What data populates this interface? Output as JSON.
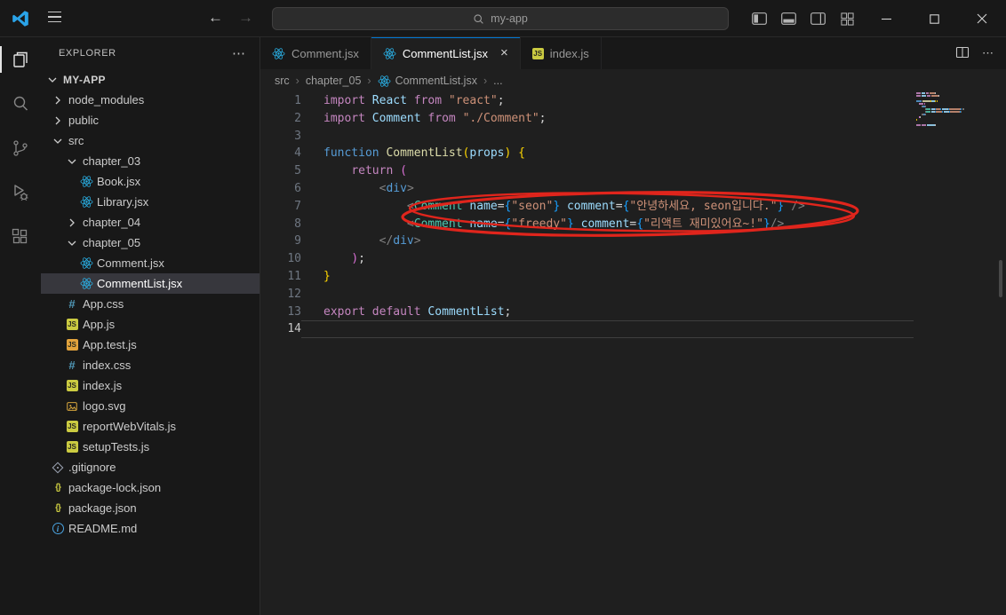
{
  "icons": {
    "more": "⋯",
    "close": "×",
    "crumb_sep": "›"
  },
  "titlebar": {
    "search": "my-app"
  },
  "activity_bar": {
    "items": [
      "explorer",
      "search",
      "source-control",
      "run-debug",
      "extensions"
    ],
    "active": "explorer"
  },
  "explorer": {
    "header": "EXPLORER",
    "root": "MY-APP",
    "items": [
      {
        "label": "node_modules",
        "kind": "folder",
        "depth": 1,
        "expanded": false
      },
      {
        "label": "public",
        "kind": "folder",
        "depth": 1,
        "expanded": false
      },
      {
        "label": "src",
        "kind": "folder",
        "depth": 1,
        "expanded": true
      },
      {
        "label": "chapter_03",
        "kind": "folder",
        "depth": 2,
        "expanded": true
      },
      {
        "label": "Book.jsx",
        "kind": "file",
        "icon": "react",
        "depth": 3
      },
      {
        "label": "Library.jsx",
        "kind": "file",
        "icon": "react",
        "depth": 3
      },
      {
        "label": "chapter_04",
        "kind": "folder",
        "depth": 2,
        "expanded": false
      },
      {
        "label": "chapter_05",
        "kind": "folder",
        "depth": 2,
        "expanded": true
      },
      {
        "label": "Comment.jsx",
        "kind": "file",
        "icon": "react",
        "depth": 3
      },
      {
        "label": "CommentList.jsx",
        "kind": "file",
        "icon": "react",
        "depth": 3,
        "selected": true
      },
      {
        "label": "App.css",
        "kind": "file",
        "icon": "css",
        "depth": 2
      },
      {
        "label": "App.js",
        "kind": "file",
        "icon": "js",
        "depth": 2
      },
      {
        "label": "App.test.js",
        "kind": "file",
        "icon": "js-test",
        "depth": 2
      },
      {
        "label": "index.css",
        "kind": "file",
        "icon": "css",
        "depth": 2
      },
      {
        "label": "index.js",
        "kind": "file",
        "icon": "js",
        "depth": 2
      },
      {
        "label": "logo.svg",
        "kind": "file",
        "icon": "svg",
        "depth": 2
      },
      {
        "label": "reportWebVitals.js",
        "kind": "file",
        "icon": "js",
        "depth": 2
      },
      {
        "label": "setupTests.js",
        "kind": "file",
        "icon": "js",
        "depth": 2
      },
      {
        "label": ".gitignore",
        "kind": "file",
        "icon": "git",
        "depth": 1
      },
      {
        "label": "package-lock.json",
        "kind": "file",
        "icon": "json",
        "depth": 1
      },
      {
        "label": "package.json",
        "kind": "file",
        "icon": "json",
        "depth": 1
      },
      {
        "label": "README.md",
        "kind": "file",
        "icon": "info",
        "depth": 1
      }
    ]
  },
  "tabs": [
    {
      "label": "Comment.jsx",
      "icon": "react",
      "active": false
    },
    {
      "label": "CommentList.jsx",
      "icon": "react",
      "active": true
    },
    {
      "label": "index.js",
      "icon": "js",
      "active": false
    }
  ],
  "breadcrumb": {
    "parts": [
      {
        "label": "src"
      },
      {
        "label": "chapter_05"
      },
      {
        "label": "CommentList.jsx",
        "icon": "react"
      },
      {
        "label": "..."
      }
    ]
  },
  "editor": {
    "active_line": 14,
    "lines": [
      {
        "n": 1,
        "t": [
          [
            "import",
            "kw"
          ],
          [
            " ",
            ""
          ],
          [
            "React",
            "var"
          ],
          [
            " ",
            ""
          ],
          [
            "from",
            "kw"
          ],
          [
            " ",
            ""
          ],
          [
            "\"react\"",
            "str"
          ],
          [
            ";",
            "pun"
          ]
        ]
      },
      {
        "n": 2,
        "t": [
          [
            "import",
            "kw"
          ],
          [
            " ",
            ""
          ],
          [
            "Comment",
            "var"
          ],
          [
            " ",
            ""
          ],
          [
            "from",
            "kw"
          ],
          [
            " ",
            ""
          ],
          [
            "\"./Comment\"",
            "str"
          ],
          [
            ";",
            "pun"
          ]
        ]
      },
      {
        "n": 3,
        "t": []
      },
      {
        "n": 4,
        "t": [
          [
            "function",
            "decl"
          ],
          [
            " ",
            ""
          ],
          [
            "CommentList",
            "fn"
          ],
          [
            "(",
            "b1"
          ],
          [
            "props",
            "var"
          ],
          [
            ")",
            "b1"
          ],
          [
            " ",
            ""
          ],
          [
            "{",
            "b1"
          ]
        ]
      },
      {
        "n": 5,
        "t": [
          [
            "    ",
            ""
          ],
          [
            "return",
            "kw"
          ],
          [
            " ",
            ""
          ],
          [
            "(",
            "b2"
          ]
        ]
      },
      {
        "n": 6,
        "t": [
          [
            "        ",
            ""
          ],
          [
            "<",
            "tagp"
          ],
          [
            "div",
            "tag"
          ],
          [
            ">",
            "tagp"
          ]
        ]
      },
      {
        "n": 7,
        "t": [
          [
            "            ",
            ""
          ],
          [
            "<",
            "tagp"
          ],
          [
            "Comment",
            "comp"
          ],
          [
            " ",
            ""
          ],
          [
            "name",
            "attr"
          ],
          [
            "=",
            "pun"
          ],
          [
            "{",
            "b3"
          ],
          [
            "\"seon\"",
            "str"
          ],
          [
            "}",
            "b3"
          ],
          [
            " ",
            ""
          ],
          [
            "comment",
            "attr"
          ],
          [
            "=",
            "pun"
          ],
          [
            "{",
            "b3"
          ],
          [
            "\"안녕하세요, seon입니다.\"",
            "str"
          ],
          [
            "}",
            "b3"
          ],
          [
            " ",
            ""
          ],
          [
            "/>",
            "tagp"
          ]
        ]
      },
      {
        "n": 8,
        "t": [
          [
            "            ",
            ""
          ],
          [
            "<",
            "tagp"
          ],
          [
            "Comment",
            "comp"
          ],
          [
            " ",
            ""
          ],
          [
            "name",
            "attr"
          ],
          [
            "=",
            "pun"
          ],
          [
            "{",
            "b3"
          ],
          [
            "\"freedy\"",
            "str"
          ],
          [
            "}",
            "b3"
          ],
          [
            " ",
            ""
          ],
          [
            "comment",
            "attr"
          ],
          [
            "=",
            "pun"
          ],
          [
            "{",
            "b3"
          ],
          [
            "\"리액트 재미있어요~!\"",
            "str"
          ],
          [
            "}",
            "b3"
          ],
          [
            "/>",
            "tagp"
          ]
        ]
      },
      {
        "n": 9,
        "t": [
          [
            "        ",
            ""
          ],
          [
            "</",
            "tagp"
          ],
          [
            "div",
            "tag"
          ],
          [
            ">",
            "tagp"
          ]
        ]
      },
      {
        "n": 10,
        "t": [
          [
            "    ",
            ""
          ],
          [
            ")",
            "b2"
          ],
          [
            ";",
            "pun"
          ]
        ]
      },
      {
        "n": 11,
        "t": [
          [
            "}",
            "b1"
          ]
        ]
      },
      {
        "n": 12,
        "t": []
      },
      {
        "n": 13,
        "t": [
          [
            "export",
            "kw"
          ],
          [
            " ",
            ""
          ],
          [
            "default",
            "kw"
          ],
          [
            " ",
            ""
          ],
          [
            "CommentList",
            "var"
          ],
          [
            ";",
            "pun"
          ]
        ]
      },
      {
        "n": 14,
        "t": []
      }
    ]
  },
  "annotation": {
    "color": "#e0251c"
  }
}
